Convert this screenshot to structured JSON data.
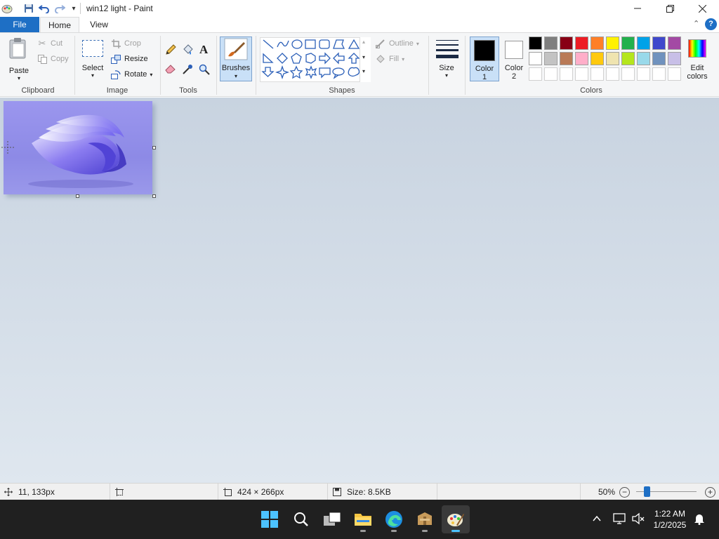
{
  "window": {
    "title": "win12 light - Paint"
  },
  "quick_access": {
    "items": [
      "paint-app-icon",
      "save-icon",
      "undo-icon",
      "redo-icon",
      "customize-qat-icon"
    ]
  },
  "tabs": {
    "file": "File",
    "home": "Home",
    "view": "View"
  },
  "clipboard": {
    "paste": "Paste",
    "cut": "Cut",
    "copy": "Copy",
    "group": "Clipboard"
  },
  "image": {
    "select": "Select",
    "crop": "Crop",
    "resize": "Resize",
    "rotate": "Rotate",
    "group": "Image"
  },
  "tools": {
    "group": "Tools"
  },
  "brushes": {
    "label": "Brushes"
  },
  "shapes": {
    "outline": "Outline",
    "fill": "Fill",
    "group": "Shapes"
  },
  "size": {
    "label": "Size"
  },
  "colors": {
    "color1": "Color 1",
    "color1_l1": "Color",
    "color1_l2": "1",
    "color2_l1": "Color",
    "color2_l2": "2",
    "edit_l1": "Edit",
    "edit_l2": "colors",
    "group": "Colors",
    "color1_value": "#000000",
    "color2_value": "#ffffff",
    "palette_row1": [
      "#000000",
      "#7f7f7f",
      "#880015",
      "#ed1c24",
      "#ff7f27",
      "#fff200",
      "#22b14c",
      "#00a2e8",
      "#3f48cc",
      "#a349a4"
    ],
    "palette_row2": [
      "#ffffff",
      "#c3c3c3",
      "#b97a57",
      "#ffaec9",
      "#ffc90e",
      "#efe4b0",
      "#b5e61d",
      "#99d9ea",
      "#7092be",
      "#c8bfe7"
    ]
  },
  "status": {
    "cursor_pos": "11, 133px",
    "image_size": "424 × 266px",
    "file_size": "Size: 8.5KB",
    "zoom": "50%",
    "zoom_level": 0.5
  },
  "taskbar": {
    "time": "1:22 AM",
    "date": "1/2/2025"
  }
}
